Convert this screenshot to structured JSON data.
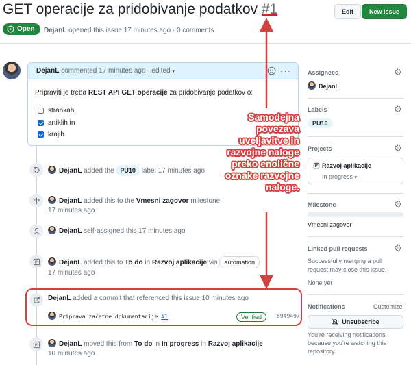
{
  "issue": {
    "title": "GET operacije za pridobivanje podatkov",
    "number": "#1",
    "state": "Open",
    "author": "DejanL",
    "meta_text": "opened this issue 17 minutes ago · 0 comments",
    "edit_label": "Edit",
    "new_issue_label": "New issue"
  },
  "comment": {
    "author": "DejanL",
    "header_text": "commented 17 minutes ago · edited",
    "body_prefix": "Pripraviti je treba ",
    "body_bold": "REST API GET operacije",
    "body_suffix": " za pridobivanje podatkov o:",
    "tasks": [
      {
        "label": "strankah,",
        "checked": false
      },
      {
        "label": "artiklih in",
        "checked": true
      },
      {
        "label": "krajih.",
        "checked": true
      }
    ]
  },
  "timeline": {
    "e1": {
      "user": "DejanL",
      "a": "added the",
      "label": "PU10",
      "b": "label 17 minutes ago"
    },
    "e2": {
      "user": "DejanL",
      "a": "added this to the",
      "milestone": "Vmesni zagovor",
      "b": "milestone",
      "time": "17 minutes ago"
    },
    "e3": {
      "user": "DejanL",
      "a": "self-assigned this 17 minutes ago"
    },
    "e4": {
      "user": "DejanL",
      "a": "added this to",
      "col": "To do",
      "in": "in",
      "project": "Razvoj aplikacije",
      "via": "via",
      "pill": "automation",
      "time": "17 minutes ago"
    },
    "e5": {
      "user": "DejanL",
      "a": "added a commit that referenced this issue 10 minutes ago",
      "commit_msg": "Priprava začetne dokumentacije",
      "commit_ref": "#1",
      "verified": "Verified",
      "sha": "6949497"
    },
    "e6": {
      "user": "DejanL",
      "a": "moved this from",
      "from": "To do",
      "in1": "in",
      "to": "In progress",
      "in2": "in",
      "project": "Razvoj aplikacije",
      "time": "10 minutes ago"
    }
  },
  "sidebar": {
    "assignees_h": "Assignees",
    "assignee": "DejanL",
    "labels_h": "Labels",
    "label": "PU10",
    "projects_h": "Projects",
    "project": "Razvoj aplikacije",
    "project_status": "In progress",
    "milestone_h": "Milestone",
    "milestone": "Vmesni zagovor",
    "linked_h": "Linked pull requests",
    "linked_text1": "Successfully merging a pull",
    "linked_text2": "request may close this issue.",
    "linked_none": "None yet",
    "notif_h": "Notifications",
    "customize": "Customize",
    "unsubscribe": "Unsubscribe",
    "notif_text1": "You're receiving notifications",
    "notif_text2": "because you're watching this",
    "notif_text3": "repository."
  },
  "annotation": {
    "lines": [
      "Samodejna",
      "povezava",
      "uveljavitve in",
      "razvojne naloge",
      "preko enolične",
      "oznake razvojne",
      "naloge."
    ],
    "color": "#d64040"
  },
  "colors": {
    "accent": "#1f883d",
    "link": "#0969da",
    "annotation": "#d64040"
  }
}
